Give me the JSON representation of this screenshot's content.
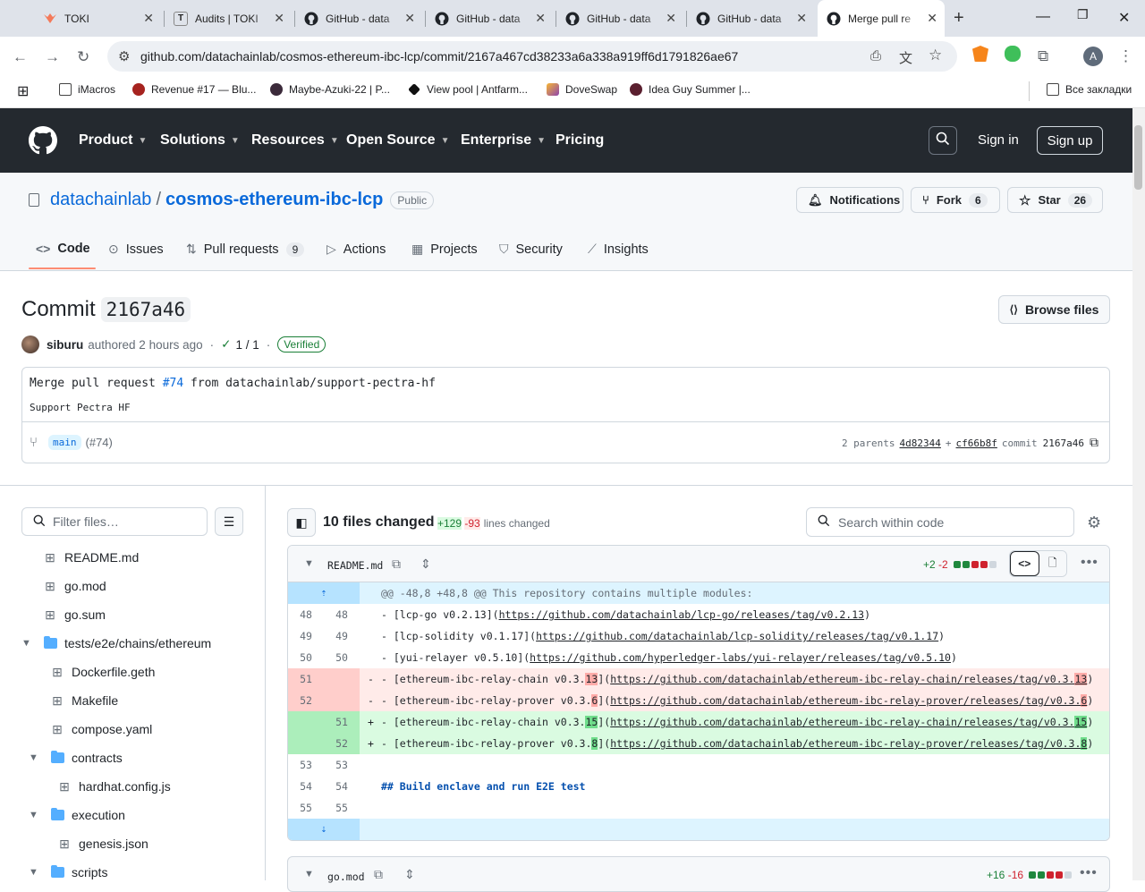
{
  "browser": {
    "tabs": [
      {
        "title": "TOKI",
        "icon": "toki-icon"
      },
      {
        "title": "Audits | TOKI",
        "icon": "toki-t-icon"
      },
      {
        "title": "GitHub - data",
        "icon": "github-icon"
      },
      {
        "title": "GitHub - data",
        "icon": "github-icon"
      },
      {
        "title": "GitHub - data",
        "icon": "github-icon"
      },
      {
        "title": "GitHub - data",
        "icon": "github-icon"
      },
      {
        "title": "Merge pull re",
        "icon": "github-icon"
      }
    ],
    "url": "github.com/datachainlab/cosmos-ethereum-ibc-lcp/commit/2167a467cd38233a6a338a919ff6d1791826ae67",
    "profile_initial": "A",
    "bookmarks": [
      {
        "label": "iMacros"
      },
      {
        "label": "Revenue #17 — Blu..."
      },
      {
        "label": "Maybe-Azuki-22 | P..."
      },
      {
        "label": "View pool | Antfarm..."
      },
      {
        "label": "DoveSwap"
      },
      {
        "label": "Idea Guy Summer |..."
      }
    ],
    "all_bookmarks": "Все закладки"
  },
  "gh": {
    "nav": [
      "Product",
      "Solutions",
      "Resources",
      "Open Source",
      "Enterprise",
      "Pricing"
    ],
    "sign_in": "Sign in",
    "sign_up": "Sign up"
  },
  "repo": {
    "owner": "datachainlab",
    "name": "cosmos-ethereum-ibc-lcp",
    "visibility": "Public",
    "notifications": "Notifications",
    "fork": "Fork",
    "fork_count": "6",
    "star": "Star",
    "star_count": "26",
    "tabs": [
      {
        "label": "Code"
      },
      {
        "label": "Issues"
      },
      {
        "label": "Pull requests",
        "count": "9"
      },
      {
        "label": "Actions"
      },
      {
        "label": "Projects"
      },
      {
        "label": "Security"
      },
      {
        "label": "Insights"
      }
    ]
  },
  "commit": {
    "title_prefix": "Commit",
    "short_sha": "2167a46",
    "browse_files": "Browse files",
    "author": "siburu",
    "authored": "authored 2 hours ago",
    "checks": "1 / 1",
    "verified": "Verified",
    "message_title_pre": "Merge pull request ",
    "message_pr": "#74",
    "message_title_post": " from datachainlab/support-pectra-hf",
    "message_body": "Support Pectra HF",
    "branch": "main",
    "branch_pr": "(#74)",
    "parents_label": "2 parents",
    "parent1": "4d82344",
    "parent_plus": "+",
    "parent2": "cf66b8f",
    "commit_label": "commit",
    "full_short": "2167a46"
  },
  "tree": {
    "filter_placeholder": "Filter files…",
    "items": [
      {
        "label": "README.md"
      },
      {
        "label": "go.mod"
      },
      {
        "label": "go.sum"
      },
      {
        "label": "tests/e2e/chains/ethereum"
      },
      {
        "label": "Dockerfile.geth"
      },
      {
        "label": "Makefile"
      },
      {
        "label": "compose.yaml"
      },
      {
        "label": "contracts"
      },
      {
        "label": "hardhat.config.js"
      },
      {
        "label": "execution"
      },
      {
        "label": "genesis.json"
      },
      {
        "label": "scripts"
      }
    ]
  },
  "diff": {
    "files_changed": "10 files changed",
    "additions": "+129",
    "deletions": "-93",
    "lines_changed": "lines changed",
    "search_placeholder": "Search within code",
    "file": {
      "name": "README.md",
      "add": "+2",
      "del": "-2",
      "hunk": "@@ -48,8 +48,8 @@ This repository contains multiple modules:",
      "lines": [
        {
          "old": "48",
          "new": "48",
          "pre": "- [lcp-go v0.2.13](",
          "url": "https://github.com/datachainlab/lcp-go/releases/tag/v0.2.13",
          "post": ")"
        },
        {
          "old": "49",
          "new": "49",
          "pre": "- [lcp-solidity v0.1.17](",
          "url": "https://github.com/datachainlab/lcp-solidity/releases/tag/v0.1.17",
          "post": ")"
        },
        {
          "old": "50",
          "new": "50",
          "pre": "- [yui-relayer v0.5.10](",
          "url": "https://github.com/hyperledger-labs/yui-relayer/releases/tag/v0.5.10",
          "post": ")"
        }
      ],
      "del_lines": [
        {
          "old": "51",
          "sign": "-",
          "a": "- [ethereum-ibc-relay-chain v0.3.",
          "ah": "13",
          "b": "](",
          "u1": "https://github.com/datachainlab/ethereum-ibc-relay-chain/releases/tag/v0.3.",
          "uh": "13",
          "c": ")"
        },
        {
          "old": "52",
          "sign": "-",
          "a": "- [ethereum-ibc-relay-prover v0.3.",
          "ah": "6",
          "b": "](",
          "u1": "https://github.com/datachainlab/ethereum-ibc-relay-prover/releases/tag/v0.3.",
          "uh": "6",
          "c": ")"
        }
      ],
      "add_lines": [
        {
          "new": "51",
          "sign": "+",
          "a": "- [ethereum-ibc-relay-chain v0.3.",
          "ah": "15",
          "b": "](",
          "u1": "https://github.com/datachainlab/ethereum-ibc-relay-chain/releases/tag/v0.3.",
          "uh": "15",
          "c": ")"
        },
        {
          "new": "52",
          "sign": "+",
          "a": "- [ethereum-ibc-relay-prover v0.3.",
          "ah": "8",
          "b": "](",
          "u1": "https://github.com/datachainlab/ethereum-ibc-relay-prover/releases/tag/v0.3.",
          "uh": "8",
          "c": ")"
        }
      ],
      "tail": [
        {
          "old": "53",
          "new": "53",
          "text": ""
        },
        {
          "old": "54",
          "new": "54",
          "text": "## Build enclave and run E2E test"
        },
        {
          "old": "55",
          "new": "55",
          "text": ""
        }
      ]
    },
    "file2": {
      "name": "go.mod",
      "add": "+16",
      "del": "-16"
    }
  }
}
